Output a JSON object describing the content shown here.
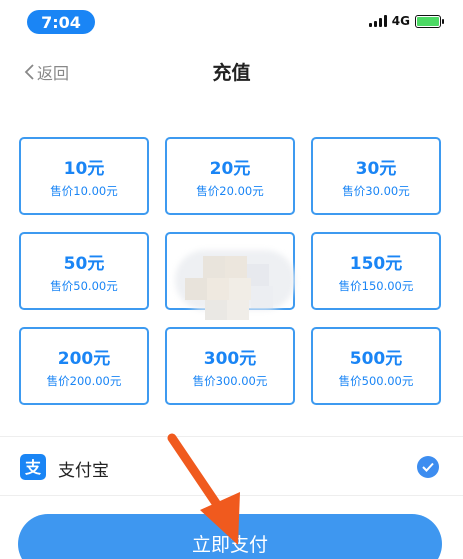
{
  "status": {
    "time": "7:04",
    "network": "4G"
  },
  "nav": {
    "back_label": "返回",
    "title": "充值"
  },
  "options": [
    {
      "amount": "10元",
      "price": "售价10.00元"
    },
    {
      "amount": "20元",
      "price": "售价20.00元"
    },
    {
      "amount": "30元",
      "price": "售价30.00元"
    },
    {
      "amount": "50元",
      "price": "售价50.00元"
    },
    {
      "amount": "",
      "price": ""
    },
    {
      "amount": "150元",
      "price": "售价150.00元"
    },
    {
      "amount": "200元",
      "price": "售价200.00元"
    },
    {
      "amount": "300元",
      "price": "售价300.00元"
    },
    {
      "amount": "500元",
      "price": "售价500.00元"
    }
  ],
  "payment": {
    "method_label": "支付宝",
    "selected": true
  },
  "action": {
    "pay_label": "立即支付"
  },
  "colors": {
    "accent": "#1a85f5",
    "button": "#3e97f0",
    "arrow": "#f05a1e"
  }
}
